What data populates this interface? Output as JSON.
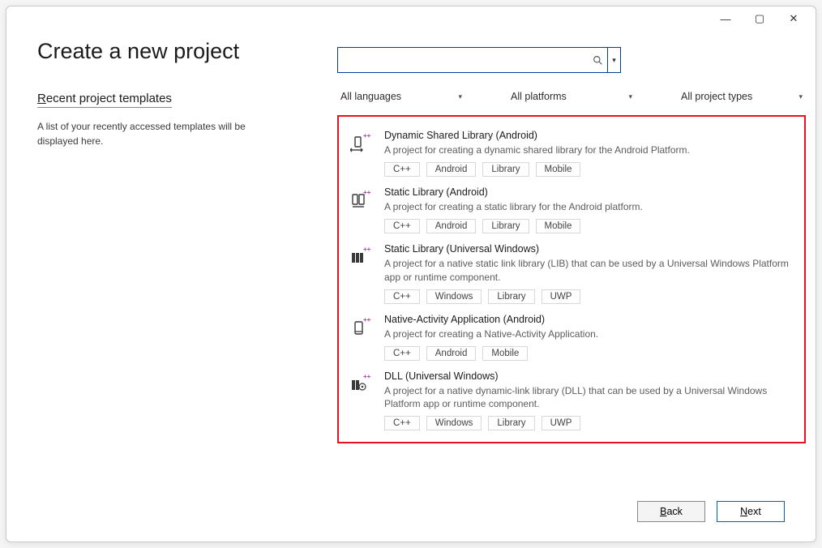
{
  "page_title": "Create a new project",
  "recent": {
    "heading_pre": "R",
    "heading_post": "ecent project templates",
    "description": "A list of your recently accessed templates will be displayed here."
  },
  "search": {
    "value": ""
  },
  "filters": {
    "language": "All languages",
    "platform": "All platforms",
    "type": "All project types"
  },
  "templates": [
    {
      "icon": "dynamic-shared-lib-icon",
      "title": "Dynamic Shared Library (Android)",
      "description": "A project for creating a dynamic shared library for the Android Platform.",
      "tags": [
        "C++",
        "Android",
        "Library",
        "Mobile"
      ]
    },
    {
      "icon": "static-lib-android-icon",
      "title": "Static Library (Android)",
      "description": "A project for creating a static library for the Android platform.",
      "tags": [
        "C++",
        "Android",
        "Library",
        "Mobile"
      ]
    },
    {
      "icon": "static-lib-uwp-icon",
      "title": "Static Library (Universal Windows)",
      "description": "A project for a native static link library (LIB) that can be used by a Universal Windows Platform app or runtime component.",
      "tags": [
        "C++",
        "Windows",
        "Library",
        "UWP"
      ]
    },
    {
      "icon": "native-activity-icon",
      "title": "Native-Activity Application (Android)",
      "description": "A project for creating a Native-Activity Application.",
      "tags": [
        "C++",
        "Android",
        "Mobile"
      ]
    },
    {
      "icon": "dll-uwp-icon",
      "title": "DLL (Universal Windows)",
      "description": "A project for a native dynamic-link library (DLL) that can be used by a Universal Windows Platform app or runtime component.",
      "tags": [
        "C++",
        "Windows",
        "Library",
        "UWP"
      ]
    }
  ],
  "buttons": {
    "back_pre": "B",
    "back_post": "ack",
    "next_pre": "N",
    "next_post": "ext"
  }
}
